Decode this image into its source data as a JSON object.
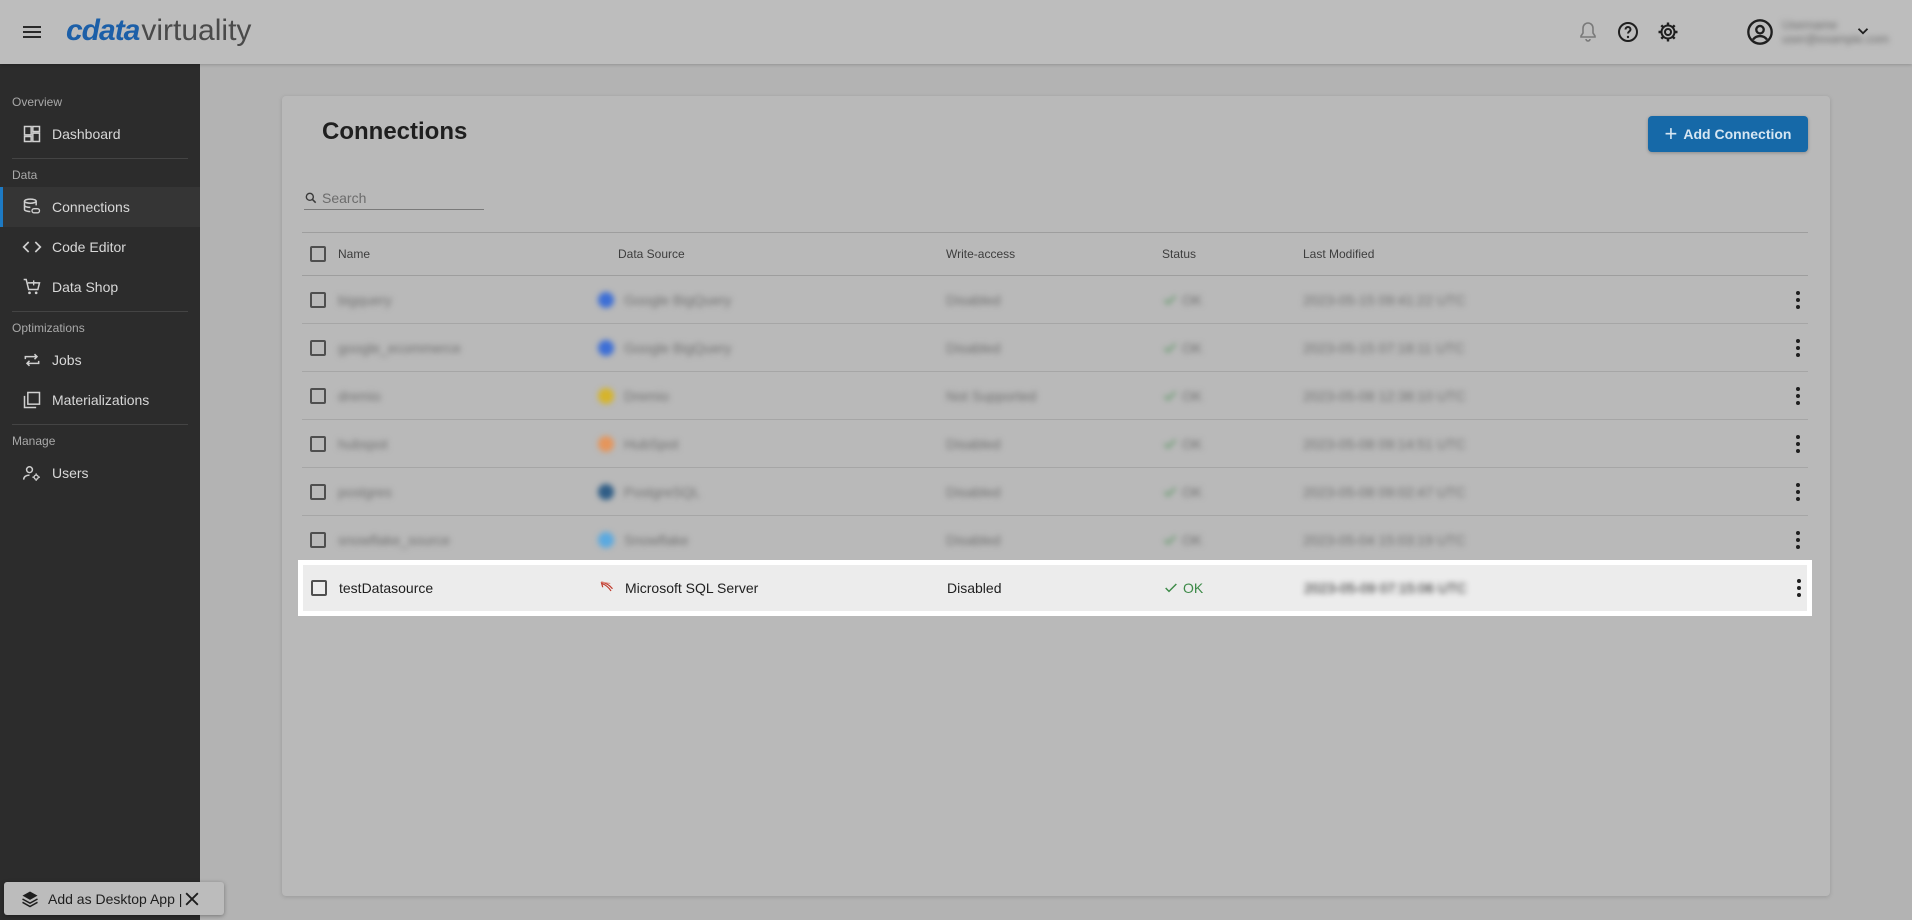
{
  "app": {
    "logo_brand": "cdata",
    "logo_product": "virtuality",
    "user_name": "Username",
    "user_email": "user@example.com"
  },
  "sidebar": {
    "sections": [
      {
        "label": "Overview",
        "items": [
          {
            "label": "Dashboard",
            "icon": "dashboard-icon"
          }
        ]
      },
      {
        "label": "Data",
        "items": [
          {
            "label": "Connections",
            "icon": "database-link-icon",
            "active": true
          },
          {
            "label": "Code Editor",
            "icon": "code-icon"
          },
          {
            "label": "Data Shop",
            "icon": "cart-icon"
          }
        ]
      },
      {
        "label": "Optimizations",
        "items": [
          {
            "label": "Jobs",
            "icon": "repeat-icon"
          },
          {
            "label": "Materializations",
            "icon": "stack-icon"
          }
        ]
      },
      {
        "label": "Manage",
        "items": [
          {
            "label": "Users",
            "icon": "user-gear-icon"
          }
        ]
      }
    ]
  },
  "page": {
    "title": "Connections",
    "add_button": "Add Connection",
    "search_placeholder": "Search"
  },
  "table": {
    "columns": [
      "Name",
      "Data Source",
      "Write-access",
      "Status",
      "Last Modified"
    ],
    "rows": [
      {
        "name": "bigquery",
        "source": "Google BigQuery",
        "source_color": "#3c6ed6",
        "write": "Disabled",
        "status": "OK",
        "modified": "2023-05-15 09:41:22 UTC",
        "blurred": true
      },
      {
        "name": "google_ecommerce",
        "source": "Google BigQuery",
        "source_color": "#3c6ed6",
        "write": "Disabled",
        "status": "OK",
        "modified": "2023-05-15 07:18:11 UTC",
        "blurred": true
      },
      {
        "name": "dremio",
        "source": "Dremio",
        "source_color": "#d6b42a",
        "write": "Not Supported",
        "status": "OK",
        "modified": "2023-05-08 12:38:10 UTC",
        "blurred": true
      },
      {
        "name": "hubspot",
        "source": "HubSpot",
        "source_color": "#e5955b",
        "write": "Disabled",
        "status": "OK",
        "modified": "2023-05-08 09:14:51 UTC",
        "blurred": true
      },
      {
        "name": "postgres",
        "source": "PostgreSQL",
        "source_color": "#2f5d86",
        "write": "Disabled",
        "status": "OK",
        "modified": "2023-05-08 09:02:47 UTC",
        "blurred": true
      },
      {
        "name": "snowflake_source",
        "source": "Snowflake",
        "source_color": "#5aa9e0",
        "write": "Disabled",
        "status": "OK",
        "modified": "2023-05-04 15:03:19 UTC",
        "blurred": true
      },
      {
        "name": "testDatasource",
        "source": "Microsoft SQL Server",
        "source_color": "#c0392b",
        "write": "Disabled",
        "status": "OK",
        "modified": "2023-05-09 07:15:06 UTC",
        "blurred": false,
        "modified_blurred": true
      }
    ]
  },
  "toast": {
    "label": "Add as Desktop App |"
  },
  "colors": {
    "accent": "#1669a8",
    "ok": "#3d8a48",
    "sidebar_bg": "#2c2c2c"
  }
}
